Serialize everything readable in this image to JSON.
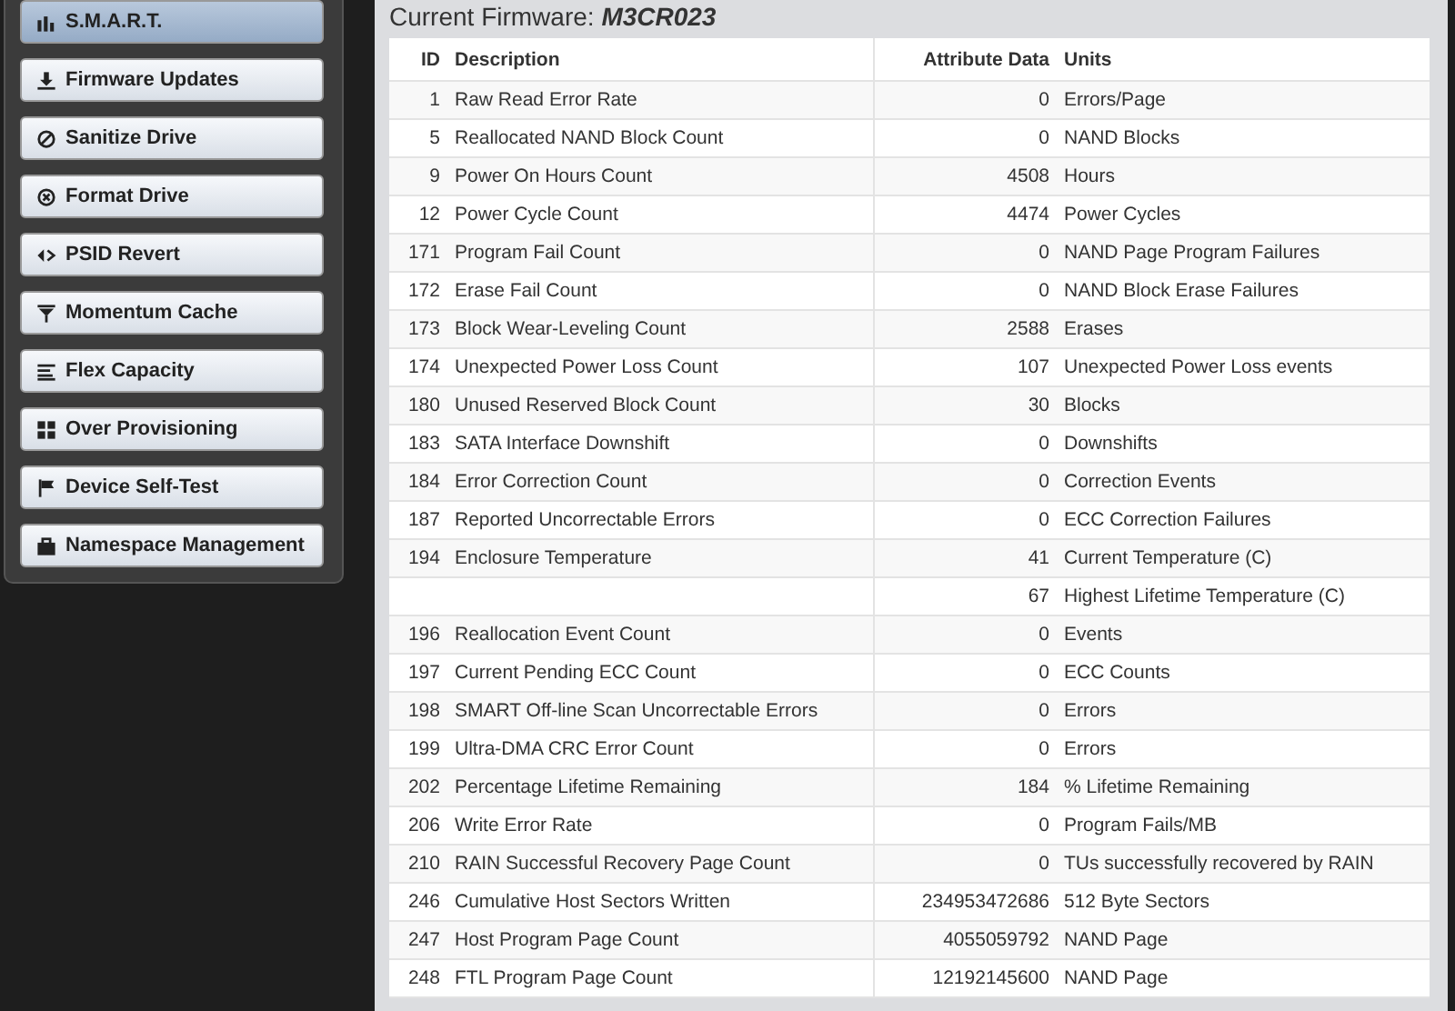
{
  "sidebar": {
    "items": [
      {
        "label": "S.M.A.R.T.",
        "selected": true
      },
      {
        "label": "Firmware Updates",
        "selected": false
      },
      {
        "label": "Sanitize Drive",
        "selected": false
      },
      {
        "label": "Format Drive",
        "selected": false
      },
      {
        "label": "PSID Revert",
        "selected": false
      },
      {
        "label": "Momentum Cache",
        "selected": false
      },
      {
        "label": "Flex Capacity",
        "selected": false
      },
      {
        "label": "Over Provisioning",
        "selected": false
      },
      {
        "label": "Device Self-Test",
        "selected": false
      },
      {
        "label": "Namespace Management",
        "selected": false
      }
    ]
  },
  "firmware": {
    "label": "Current Firmware:",
    "value": "M3CR023"
  },
  "table": {
    "columns": [
      "ID",
      "Description",
      "Attribute Data",
      "Units"
    ],
    "rows": [
      [
        "1",
        "Raw Read Error Rate",
        "0",
        "Errors/Page"
      ],
      [
        "5",
        "Reallocated NAND Block Count",
        "0",
        "NAND Blocks"
      ],
      [
        "9",
        "Power On Hours Count",
        "4508",
        "Hours"
      ],
      [
        "12",
        "Power Cycle Count",
        "4474",
        "Power Cycles"
      ],
      [
        "171",
        "Program Fail Count",
        "0",
        "NAND Page Program Failures"
      ],
      [
        "172",
        "Erase Fail Count",
        "0",
        "NAND Block Erase Failures"
      ],
      [
        "173",
        "Block Wear-Leveling Count",
        "2588",
        "Erases"
      ],
      [
        "174",
        "Unexpected Power Loss Count",
        "107",
        "Unexpected Power Loss events"
      ],
      [
        "180",
        "Unused Reserved Block Count",
        "30",
        "Blocks"
      ],
      [
        "183",
        "SATA Interface Downshift",
        "0",
        "Downshifts"
      ],
      [
        "184",
        "Error Correction Count",
        "0",
        "Correction Events"
      ],
      [
        "187",
        "Reported Uncorrectable Errors",
        "0",
        "ECC Correction Failures"
      ],
      [
        "194",
        "Enclosure Temperature",
        "41",
        "Current Temperature (C)"
      ],
      [
        "",
        "",
        "67",
        "Highest Lifetime Temperature (C)"
      ],
      [
        "196",
        "Reallocation Event Count",
        "0",
        "Events"
      ],
      [
        "197",
        "Current Pending ECC Count",
        "0",
        "ECC Counts"
      ],
      [
        "198",
        "SMART Off-line Scan Uncorrectable Errors",
        "0",
        "Errors"
      ],
      [
        "199",
        "Ultra-DMA CRC Error Count",
        "0",
        "Errors"
      ],
      [
        "202",
        "Percentage Lifetime Remaining",
        "184",
        "% Lifetime Remaining"
      ],
      [
        "206",
        "Write Error Rate",
        "0",
        "Program Fails/MB"
      ],
      [
        "210",
        "RAIN Successful Recovery Page Count",
        "0",
        "TUs successfully recovered by RAIN"
      ],
      [
        "246",
        "Cumulative Host Sectors Written",
        "234953472686",
        "512 Byte Sectors"
      ],
      [
        "247",
        "Host Program Page Count",
        "4055059792",
        "NAND Page"
      ],
      [
        "248",
        "FTL Program Page Count",
        "12192145600",
        "NAND Page"
      ]
    ]
  }
}
